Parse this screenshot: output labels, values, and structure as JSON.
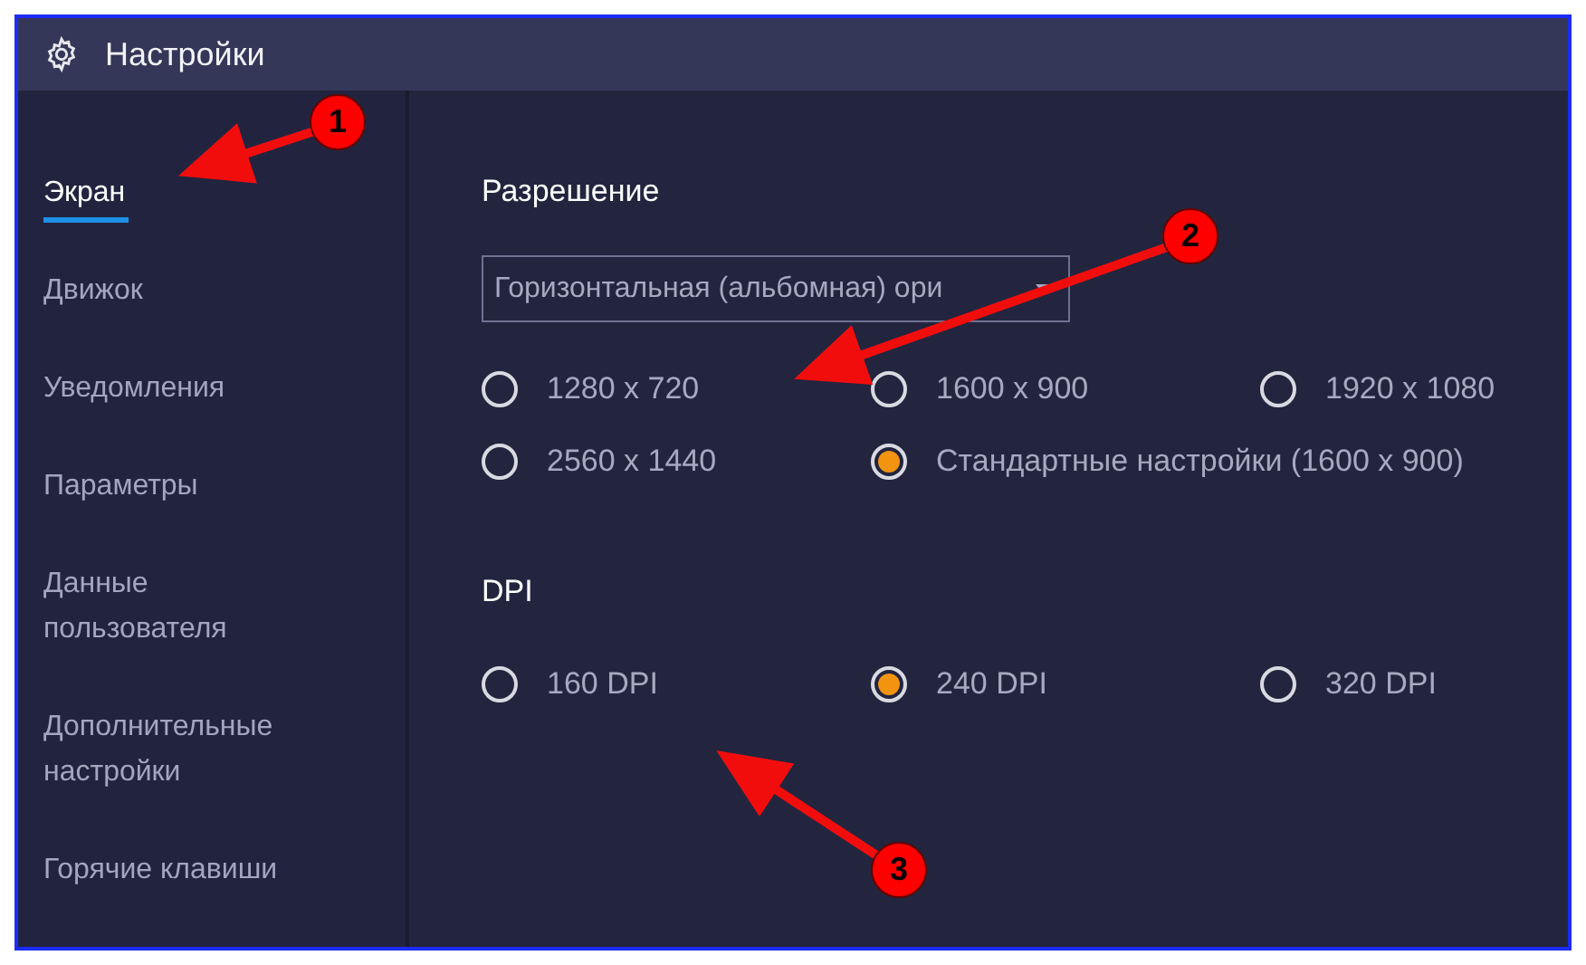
{
  "window": {
    "title": "Настройки"
  },
  "sidebar": {
    "items": [
      {
        "label": "Экран",
        "selected": true
      },
      {
        "label": "Движок",
        "selected": false
      },
      {
        "label": "Уведомления",
        "selected": false
      },
      {
        "label": "Параметры",
        "selected": false
      },
      {
        "label": "Данные пользователя",
        "selected": false
      },
      {
        "label": "Дополнительные настройки",
        "selected": false
      },
      {
        "label": "Горячие клавиши",
        "selected": false
      }
    ]
  },
  "resolution": {
    "heading": "Разрешение",
    "orientation": {
      "value": "Горизонтальная (альбомная) ори"
    },
    "options": [
      {
        "label": "1280 x 720",
        "selected": false
      },
      {
        "label": "1600 x 900",
        "selected": false
      },
      {
        "label": "1920 x 1080",
        "selected": false
      },
      {
        "label": "2560 x 1440",
        "selected": false
      },
      {
        "label": "Стандартные настройки (1600 x 900)",
        "selected": true
      }
    ]
  },
  "dpi": {
    "heading": "DPI",
    "options": [
      {
        "label": "160 DPI",
        "selected": false
      },
      {
        "label": "240 DPI",
        "selected": true
      },
      {
        "label": "320 DPI",
        "selected": false
      }
    ]
  },
  "annotations": [
    {
      "label": "1"
    },
    {
      "label": "2"
    },
    {
      "label": "3"
    }
  ]
}
